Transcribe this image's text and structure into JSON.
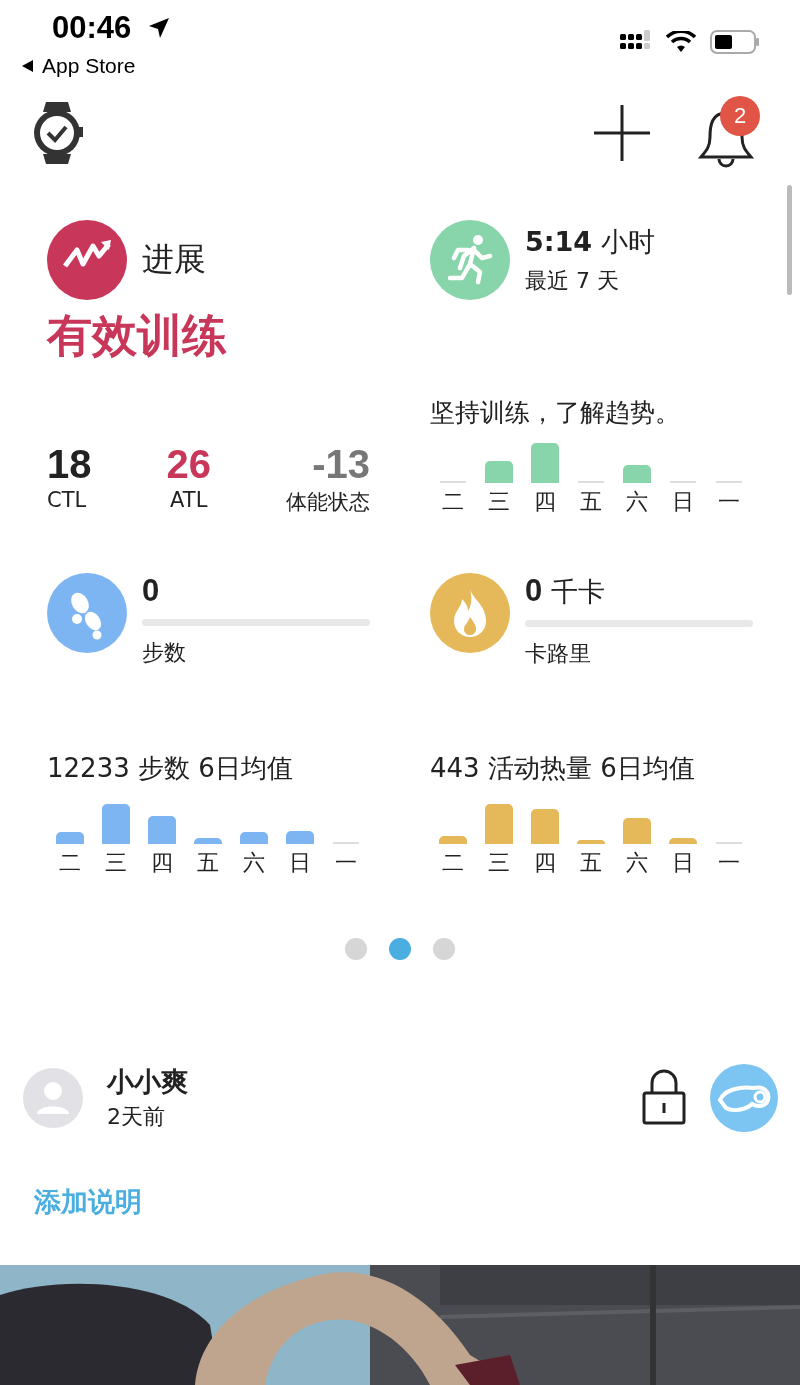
{
  "status_bar": {
    "time": "00:46",
    "back_label": "App Store"
  },
  "header": {
    "notification_count": "2"
  },
  "progress": {
    "title": "进展",
    "status": "有效训练",
    "metrics": [
      {
        "value": "18",
        "label": "CTL",
        "kind": "neutral"
      },
      {
        "value": "26",
        "label": "ATL",
        "kind": "fatigue"
      },
      {
        "value": "-13",
        "label": "体能状态",
        "kind": "form"
      }
    ]
  },
  "training": {
    "duration": "5:14",
    "unit": "小时",
    "period": "最近 7 天",
    "message": "坚持训练，了解趋势。",
    "days": [
      "二",
      "三",
      "四",
      "五",
      "六",
      "日",
      "一"
    ]
  },
  "steps": {
    "value": "0",
    "label": "步数",
    "level": 0,
    "average": "12233 步数 6日均值",
    "days": [
      "二",
      "三",
      "四",
      "五",
      "六",
      "日",
      "一"
    ]
  },
  "calories": {
    "value": "0",
    "unit": "千卡",
    "label": "卡路里",
    "level": 0,
    "average": "443 活动热量 6日均值",
    "days": [
      "二",
      "三",
      "四",
      "五",
      "六",
      "日",
      "一"
    ]
  },
  "pager": [
    {
      "selected": false
    },
    {
      "selected": true
    },
    {
      "selected": false
    }
  ],
  "post": {
    "user": "小小爽",
    "time": "2天前",
    "add_caption": "添加说明"
  }
}
